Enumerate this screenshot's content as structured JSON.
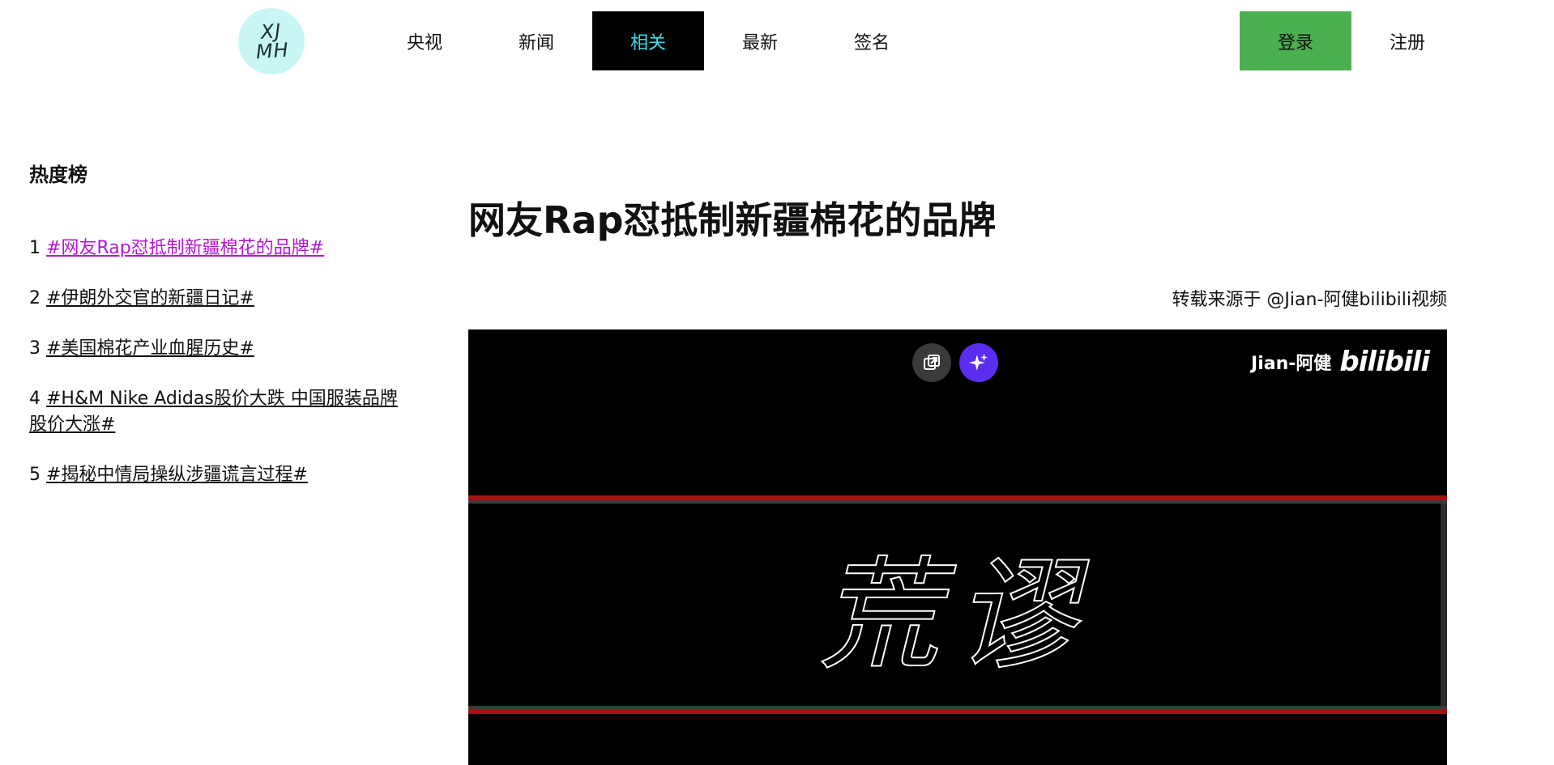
{
  "logo": {
    "text": "XJ\nMH"
  },
  "nav": {
    "items": [
      {
        "label": "央视"
      },
      {
        "label": "新闻"
      },
      {
        "label": "相关"
      },
      {
        "label": "最新"
      },
      {
        "label": "签名"
      }
    ],
    "active_index": 2,
    "login_label": "登录",
    "register_label": "注册"
  },
  "sidebar": {
    "title": "热度榜",
    "items": [
      {
        "rank": "1",
        "text": "#网友Rap怼抵制新疆棉花的品牌#",
        "visited": true
      },
      {
        "rank": "2",
        "text": "#伊朗外交官的新疆日记#",
        "visited": false
      },
      {
        "rank": "3",
        "text": "#美国棉花产业血腥历史#",
        "visited": false
      },
      {
        "rank": "4",
        "text": "#H&M Nike Adidas股价大跌 中国服装品牌股价大涨#",
        "visited": false
      },
      {
        "rank": "5",
        "text": "#揭秘中情局操纵涉疆谎言过程#",
        "visited": false
      }
    ]
  },
  "article": {
    "title": "网友Rap怼抵制新疆棉花的品牌",
    "source": "转载来源于 @Jian-阿健bilibili视频"
  },
  "video": {
    "watermark_name": "Jian-阿健",
    "watermark_logo": "bilibili",
    "caption": "荒谬"
  },
  "colors": {
    "nav_active_bg": "#000000",
    "nav_active_text": "#35e0e8",
    "login_bg": "#4caf50",
    "logo_bg": "#c8f6f4",
    "visited_link": "#b416d6",
    "video_band_red": "#a31212"
  }
}
